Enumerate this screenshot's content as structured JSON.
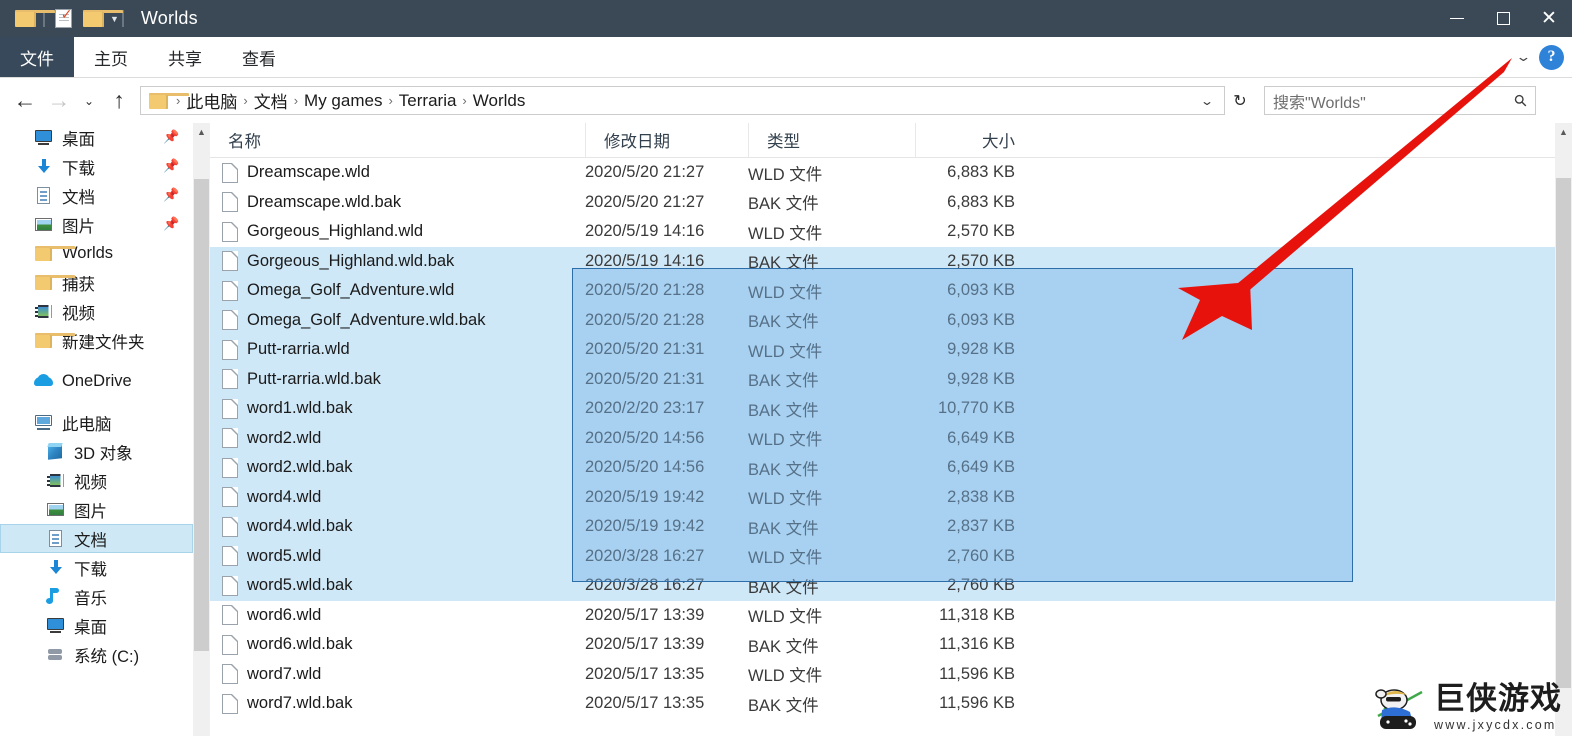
{
  "window": {
    "title": "Worlds",
    "quick_access": [
      {
        "name": "folder-icon",
        "label": "folder"
      },
      {
        "name": "properties-icon",
        "label": "properties"
      },
      {
        "name": "new-folder-icon",
        "label": "new folder"
      }
    ],
    "controls": {
      "minimize": "minimize",
      "maximize": "maximize",
      "close": "close"
    }
  },
  "ribbon": {
    "file_tab": "文件",
    "tabs": [
      "主页",
      "共享",
      "查看"
    ],
    "collapse": "chevron-down",
    "help": "?"
  },
  "address": {
    "back": "←",
    "forward": "→",
    "recent": "⌄",
    "up": "↑",
    "breadcrumbs": [
      "此电脑",
      "文档",
      "My games",
      "Terraria",
      "Worlds"
    ],
    "dropdown": "⌄",
    "refresh": "↻"
  },
  "search": {
    "placeholder": "搜索\"Worlds\"",
    "icon": "search-icon"
  },
  "sidebar": {
    "quick_access": [
      {
        "label": "桌面",
        "icon": "desktop-icon",
        "pinned": true
      },
      {
        "label": "下载",
        "icon": "download-icon",
        "pinned": true
      },
      {
        "label": "文档",
        "icon": "documents-icon",
        "pinned": true
      },
      {
        "label": "图片",
        "icon": "pictures-icon",
        "pinned": true
      },
      {
        "label": "Worlds",
        "icon": "folder-icon",
        "pinned": false
      },
      {
        "label": "捕获",
        "icon": "folder-icon",
        "pinned": false
      },
      {
        "label": "视频",
        "icon": "video-icon",
        "pinned": false
      },
      {
        "label": "新建文件夹",
        "icon": "folder-icon",
        "pinned": false
      }
    ],
    "onedrive": {
      "label": "OneDrive",
      "icon": "cloud-icon"
    },
    "this_pc": {
      "label": "此电脑",
      "icon": "pc-icon"
    },
    "this_pc_children": [
      {
        "label": "3D 对象",
        "icon": "3d-objects-icon",
        "selected": false
      },
      {
        "label": "视频",
        "icon": "video-icon",
        "selected": false
      },
      {
        "label": "图片",
        "icon": "pictures-icon",
        "selected": false
      },
      {
        "label": "文档",
        "icon": "documents-icon",
        "selected": true
      },
      {
        "label": "下载",
        "icon": "download-icon",
        "selected": false
      },
      {
        "label": "音乐",
        "icon": "music-icon",
        "selected": false
      },
      {
        "label": "桌面",
        "icon": "desktop-icon",
        "selected": false
      },
      {
        "label": "系统 (C:)",
        "icon": "disk-icon",
        "selected": false
      }
    ]
  },
  "filelist": {
    "columns": [
      "名称",
      "修改日期",
      "类型",
      "大小"
    ],
    "sort_column": "名称",
    "sort_direction": "asc",
    "rows": [
      {
        "name": "Dreamscape.wld",
        "date": "2020/5/20 21:27",
        "type": "WLD 文件",
        "size": "6,883 KB",
        "selected": false
      },
      {
        "name": "Dreamscape.wld.bak",
        "date": "2020/5/20 21:27",
        "type": "BAK 文件",
        "size": "6,883 KB",
        "selected": false
      },
      {
        "name": "Gorgeous_Highland.wld",
        "date": "2020/5/19 14:16",
        "type": "WLD 文件",
        "size": "2,570 KB",
        "selected": false
      },
      {
        "name": "Gorgeous_Highland.wld.bak",
        "date": "2020/5/19 14:16",
        "type": "BAK 文件",
        "size": "2,570 KB",
        "selected": true
      },
      {
        "name": "Omega_Golf_Adventure.wld",
        "date": "2020/5/20 21:28",
        "type": "WLD 文件",
        "size": "6,093 KB",
        "selected": true
      },
      {
        "name": "Omega_Golf_Adventure.wld.bak",
        "date": "2020/5/20 21:28",
        "type": "BAK 文件",
        "size": "6,093 KB",
        "selected": true
      },
      {
        "name": "Putt-rarria.wld",
        "date": "2020/5/20 21:31",
        "type": "WLD 文件",
        "size": "9,928 KB",
        "selected": true
      },
      {
        "name": "Putt-rarria.wld.bak",
        "date": "2020/5/20 21:31",
        "type": "BAK 文件",
        "size": "9,928 KB",
        "selected": true
      },
      {
        "name": "word1.wld.bak",
        "date": "2020/2/20 23:17",
        "type": "BAK 文件",
        "size": "10,770 KB",
        "selected": true
      },
      {
        "name": "word2.wld",
        "date": "2020/5/20 14:56",
        "type": "WLD 文件",
        "size": "6,649 KB",
        "selected": true
      },
      {
        "name": "word2.wld.bak",
        "date": "2020/5/20 14:56",
        "type": "BAK 文件",
        "size": "6,649 KB",
        "selected": true
      },
      {
        "name": "word4.wld",
        "date": "2020/5/19 19:42",
        "type": "WLD 文件",
        "size": "2,838 KB",
        "selected": true
      },
      {
        "name": "word4.wld.bak",
        "date": "2020/5/19 19:42",
        "type": "BAK 文件",
        "size": "2,837 KB",
        "selected": true
      },
      {
        "name": "word5.wld",
        "date": "2020/3/28 16:27",
        "type": "WLD 文件",
        "size": "2,760 KB",
        "selected": true
      },
      {
        "name": "word5.wld.bak",
        "date": "2020/3/28 16:27",
        "type": "BAK 文件",
        "size": "2,760 KB",
        "selected": true
      },
      {
        "name": "word6.wld",
        "date": "2020/5/17 13:39",
        "type": "WLD 文件",
        "size": "11,318 KB",
        "selected": false
      },
      {
        "name": "word6.wld.bak",
        "date": "2020/5/17 13:39",
        "type": "BAK 文件",
        "size": "11,316 KB",
        "selected": false
      },
      {
        "name": "word7.wld",
        "date": "2020/5/17 13:35",
        "type": "WLD 文件",
        "size": "11,596 KB",
        "selected": false
      },
      {
        "name": "word7.wld.bak",
        "date": "2020/5/17 13:35",
        "type": "BAK 文件",
        "size": "11,596 KB",
        "selected": false
      }
    ]
  },
  "annotation": {
    "arrow_color": "#e8120c",
    "marquee_fill": "#78b4e6",
    "marquee_border": "#2e6ea8"
  },
  "watermark": {
    "title": "巨侠游戏",
    "url": "www.jxycdx.com"
  }
}
